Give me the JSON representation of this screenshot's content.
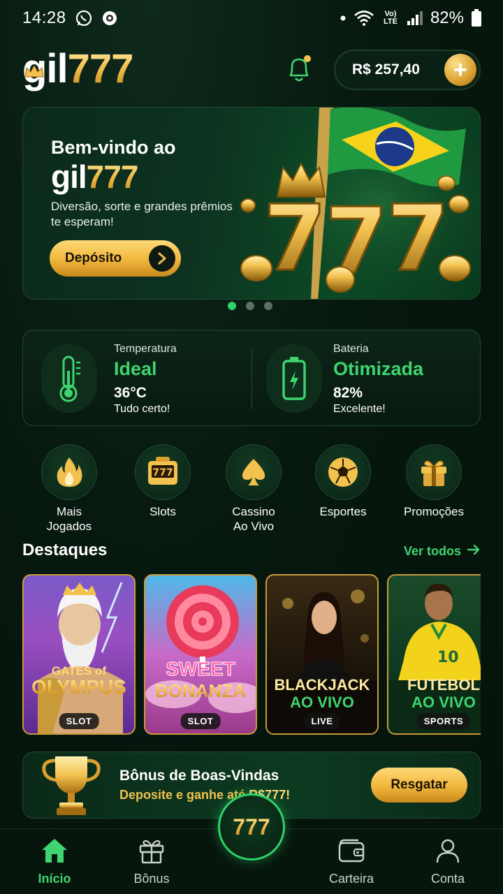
{
  "status_bar": {
    "time": "14:28",
    "battery": "82%",
    "network": "Vo) LTE"
  },
  "header": {
    "logo_main": "gil",
    "logo_num": "777",
    "balance": "R$ 257,40"
  },
  "hero": {
    "welcome": "Bem-vindo ao",
    "logo_main": "gil",
    "logo_num": "777",
    "subtitle": "Diversão, sorte e grandes prêmios te esperam!",
    "deposit_label": "Depósito",
    "art_text": "777",
    "slides": 3,
    "active_slide": 1
  },
  "device_status": {
    "temperature": {
      "label": "Temperatura",
      "status": "Ideal",
      "value": "36°C",
      "note": "Tudo certo!"
    },
    "battery": {
      "label": "Bateria",
      "status": "Otimizada",
      "value": "82%",
      "note": "Excelente!"
    }
  },
  "categories": [
    {
      "label": "Mais\nJogados",
      "icon": "flame-icon"
    },
    {
      "label": "Slots",
      "icon": "slot-machine-icon"
    },
    {
      "label": "Cassino\nAo Vivo",
      "icon": "spade-icon"
    },
    {
      "label": "Esportes",
      "icon": "soccer-ball-icon"
    },
    {
      "label": "Promoções",
      "icon": "gift-icon"
    }
  ],
  "highlights": {
    "title": "Destaques",
    "see_all": "Ver todos",
    "games": [
      {
        "title_line1": "GATES of",
        "title_line2": "OLYMPUS",
        "badge": "SLOT"
      },
      {
        "title_line1": "SWEET",
        "title_line2": "BONANZA",
        "badge": "SLOT"
      },
      {
        "title_line1": "BLACKJACK",
        "title_line2": "AO VIVO",
        "badge": "LIVE"
      },
      {
        "title_line1": "FUTEBOL",
        "title_line2": "AO VIVO",
        "badge": "SPORTS"
      }
    ]
  },
  "bonus": {
    "title": "Bônus de Boas-Vindas",
    "subtitle": "Deposite e ganhe até",
    "amount": "R$777!",
    "claim_label": "Resgatar"
  },
  "bottom_nav": {
    "items": [
      {
        "label": "Início",
        "icon": "home-icon",
        "active": true
      },
      {
        "label": "Bônus",
        "icon": "gift-icon"
      },
      {
        "label": "Carteira",
        "icon": "wallet-icon"
      },
      {
        "label": "Conta",
        "icon": "user-icon"
      }
    ],
    "center_label": "777"
  },
  "colors": {
    "accent_green": "#3fd46f",
    "gold": "#f2c14e",
    "background": "#07180f"
  }
}
